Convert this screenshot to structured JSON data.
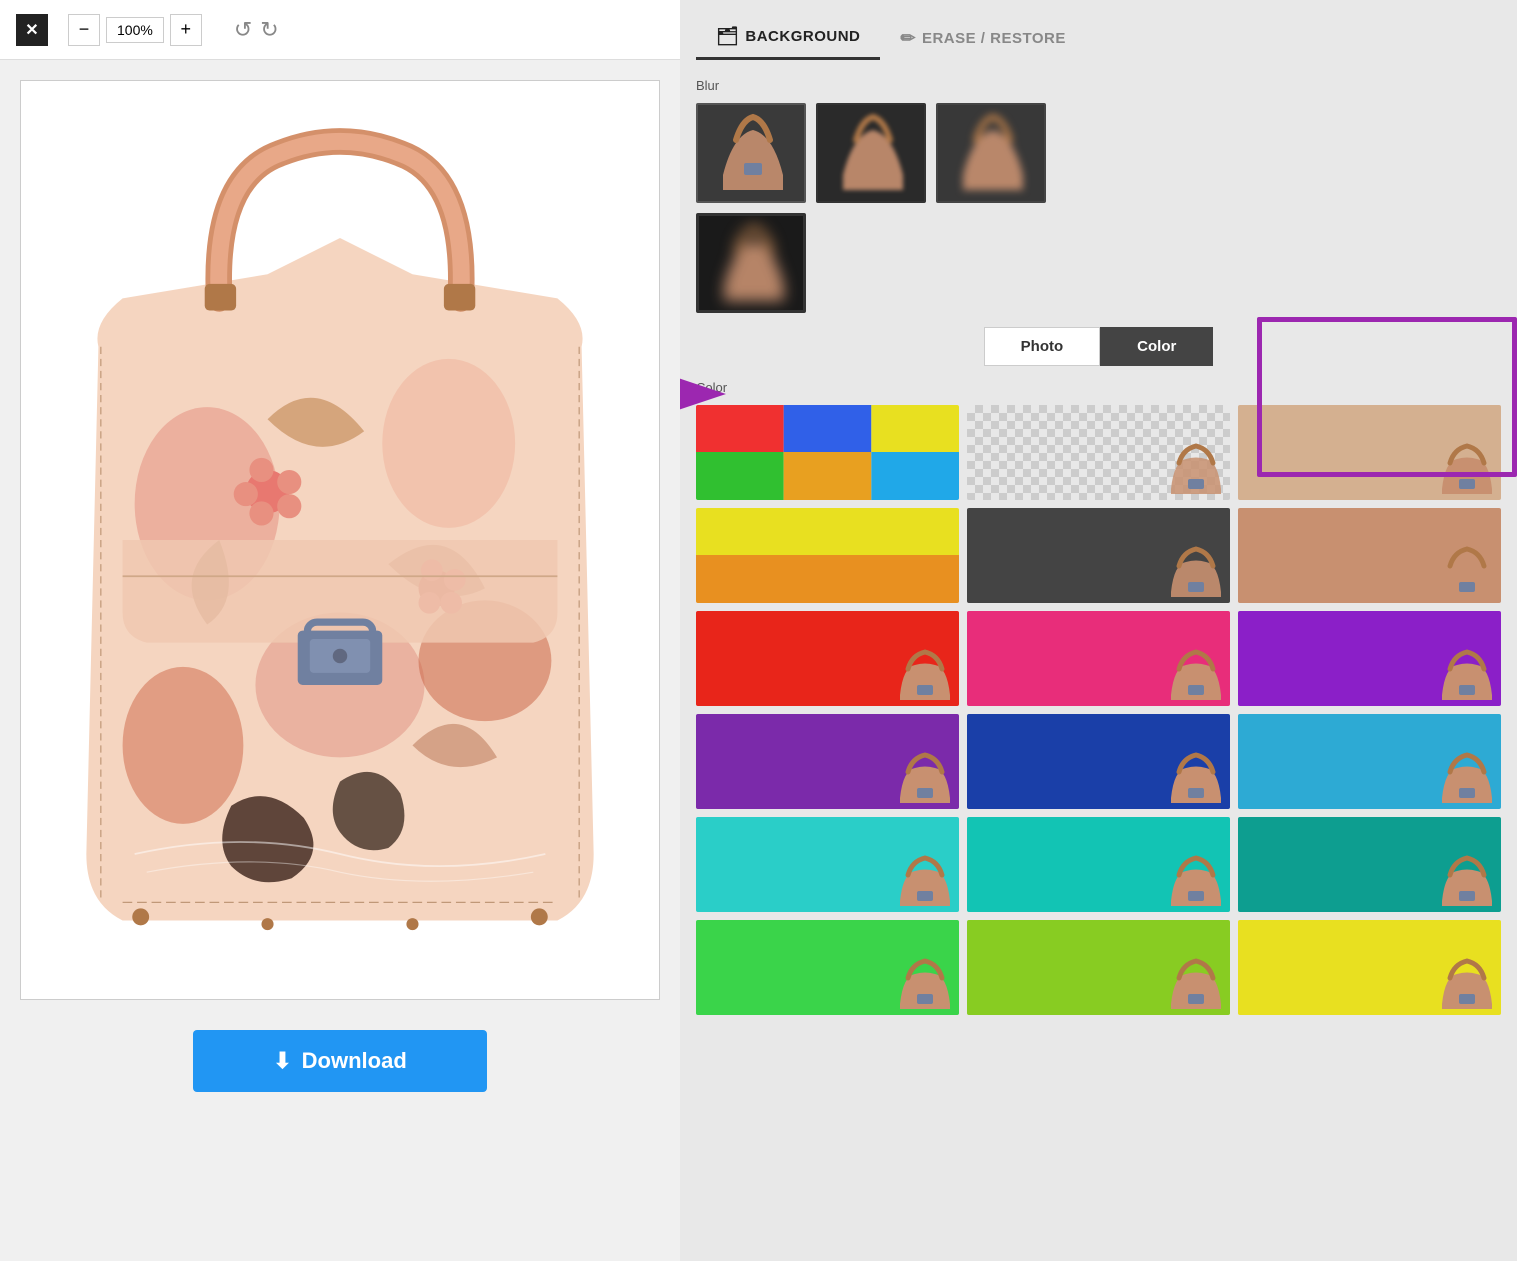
{
  "toolbar": {
    "close_label": "✕",
    "zoom_minus": "−",
    "zoom_value": "100%",
    "zoom_plus": "+",
    "undo_icon": "↺",
    "redo_icon": "↻"
  },
  "download": {
    "label": "Download",
    "icon": "⬇"
  },
  "tabs": [
    {
      "id": "background",
      "label": "BACKGROUND",
      "icon": "🗂",
      "active": true
    },
    {
      "id": "erase-restore",
      "label": "ERASE / RESTORE",
      "icon": "✏",
      "active": false
    }
  ],
  "sections": {
    "blur": {
      "label": "Blur",
      "thumbnails": [
        {
          "id": "blur-0",
          "label": "No blur",
          "selected": false
        },
        {
          "id": "blur-1",
          "label": "Low blur",
          "selected": false
        },
        {
          "id": "blur-2",
          "label": "Medium blur",
          "selected": false
        },
        {
          "id": "blur-3",
          "label": "High blur",
          "selected": true
        }
      ]
    },
    "toggle": {
      "photo_label": "Photo",
      "color_label": "Color",
      "active": "color"
    },
    "color": {
      "label": "Color",
      "items": [
        {
          "id": "multi-colors",
          "type": "swatch-multi",
          "bg": "multi"
        },
        {
          "id": "transparent",
          "type": "transparent",
          "bg": "transparent"
        },
        {
          "id": "bag-plain",
          "type": "bag",
          "bg": "#d4a080"
        },
        {
          "id": "yellow-green",
          "type": "swatch-yg",
          "bg": "yellow-green"
        },
        {
          "id": "dark-grey-bag",
          "type": "bag",
          "bg": "#555555"
        },
        {
          "id": "bag-skin",
          "type": "bag",
          "bg": "#c89070"
        },
        {
          "id": "red-bg",
          "type": "bag",
          "bg": "#e8251a"
        },
        {
          "id": "pink-bg",
          "type": "bag",
          "bg": "#e82d7a"
        },
        {
          "id": "purple-bg",
          "type": "bag",
          "bg": "#8b1fc8"
        },
        {
          "id": "purple2-bg",
          "type": "bag",
          "bg": "#7b2aaa"
        },
        {
          "id": "blue-bg",
          "type": "bag",
          "bg": "#1a3fa8"
        },
        {
          "id": "cyan-bg",
          "type": "bag",
          "bg": "#2daad4"
        },
        {
          "id": "teal-bg",
          "type": "bag",
          "bg": "#2acec8"
        },
        {
          "id": "teal2-bg",
          "type": "bag",
          "bg": "#12c4b4"
        },
        {
          "id": "teal3-bg",
          "type": "bag",
          "bg": "#0d9e90"
        },
        {
          "id": "green-bg",
          "type": "bag",
          "bg": "#3ad44a"
        },
        {
          "id": "green2-bg",
          "type": "bag",
          "bg": "#88cc22"
        },
        {
          "id": "yellow-bg",
          "type": "bag",
          "bg": "#e8e020"
        }
      ]
    }
  },
  "highlight": {
    "box": {
      "label": "Color button highlight",
      "color": "#9c27b0"
    },
    "arrow": {
      "label": "Arrow pointing right",
      "color": "#9c27b0"
    }
  }
}
